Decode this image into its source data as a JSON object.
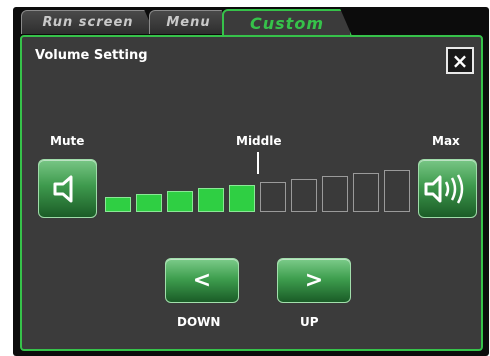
{
  "tabs": [
    {
      "label": "Run screen",
      "active": false
    },
    {
      "label": "Menu",
      "active": false
    },
    {
      "label": "Custom",
      "active": true
    }
  ],
  "dialog": {
    "title": "Volume Setting",
    "close_label": "×"
  },
  "volume": {
    "mute_label": "Mute",
    "middle_label": "Middle",
    "max_label": "Max",
    "level": 5,
    "total_steps": 10
  },
  "nav": {
    "down_symbol": "<",
    "up_symbol": ">",
    "down_label": "DOWN",
    "up_label": "UP"
  },
  "colors": {
    "accent": "#36c24a",
    "bar_on": "#2fcf43",
    "bar_off": "#3a3a3a",
    "panel": "#3b3b3b"
  },
  "icons": {
    "mute": "speaker-icon",
    "max": "speaker-waves-icon"
  }
}
